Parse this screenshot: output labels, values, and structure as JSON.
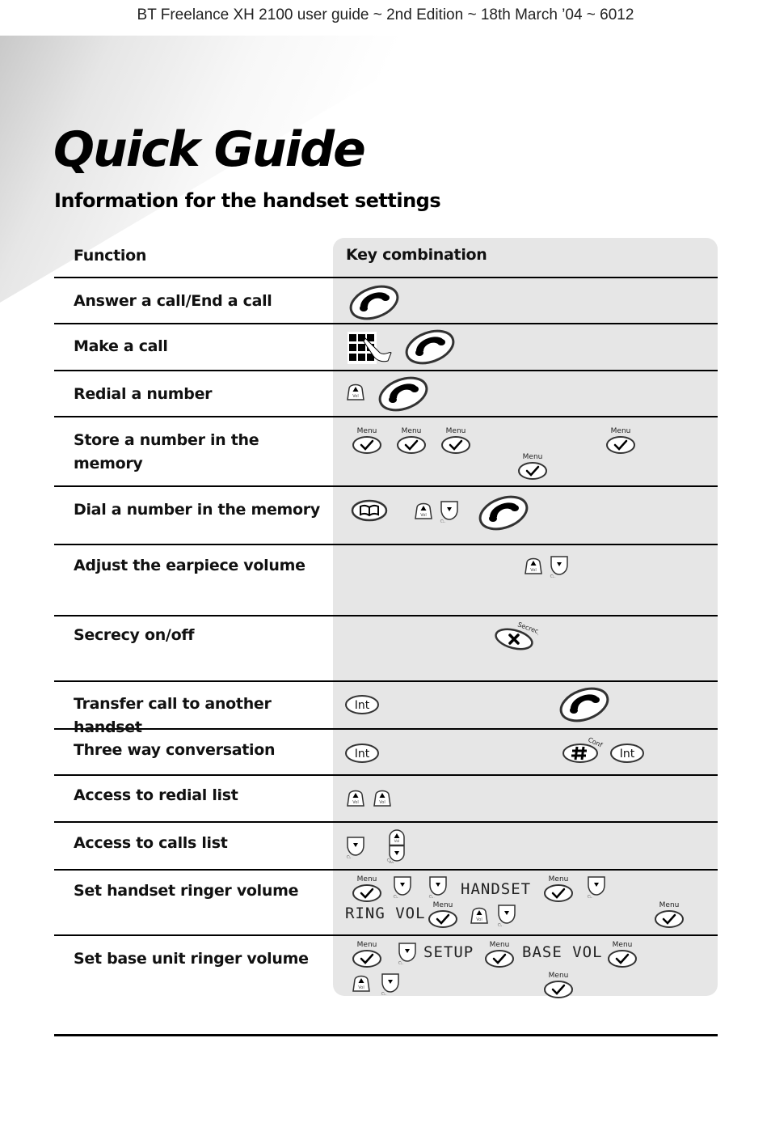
{
  "running_head": "BT Freelance XH 2100 user guide ~ 2nd Edition ~ 18th March ’04 ~ 6012",
  "title": "Quick Guide",
  "subtitle": "Information for the handset settings",
  "table": {
    "headers": {
      "function": "Function",
      "keys": "Key combination"
    },
    "rows": [
      {
        "function": "Answer a call/End a call",
        "keys": [
          "talk-key"
        ]
      },
      {
        "function": "Make a call",
        "keys": [
          "keypad",
          "talk-key"
        ]
      },
      {
        "function": "Redial a number",
        "keys": [
          "vol-up-key",
          "talk-key"
        ]
      },
      {
        "function": "Store a number in the memory",
        "keys": [
          "menu-key",
          "menu-key",
          "menu-key",
          "menu-key",
          "menu-key"
        ]
      },
      {
        "function": "Dial a number in the memory",
        "keys": [
          "phonebook-key",
          "vol-up-key",
          "calls-down-key",
          "talk-key"
        ]
      },
      {
        "function": "Adjust the earpiece volume",
        "keys": [
          "vol-up-key",
          "calls-down-key"
        ]
      },
      {
        "function": "Secrecy on/off",
        "keys": [
          "secrecy-key"
        ]
      },
      {
        "function": "Transfer call to another handset",
        "keys": [
          "int-key",
          "talk-key"
        ]
      },
      {
        "function": "Three way conversation",
        "keys": [
          "int-key",
          "conf-hash-key",
          "int-key"
        ]
      },
      {
        "function": "Access to redial list",
        "keys": [
          "vol-up-key",
          "vol-up-key"
        ]
      },
      {
        "function": "Access to calls list",
        "keys": [
          "calls-down-key",
          "vol-rocker-key"
        ]
      },
      {
        "function": "Set handset ringer volume",
        "keys": [
          "menu-key",
          "calls-down-key",
          "calls-down-key",
          "HANDSET",
          "menu-key",
          "calls-down-key",
          "RING VOL",
          "menu-key",
          "vol-up-key",
          "calls-down-key",
          "menu-key"
        ]
      },
      {
        "function": "Set base unit ringer volume",
        "keys": [
          "menu-key",
          "calls-down-key",
          "SETUP",
          "menu-key",
          "BASE VOL",
          "menu-key",
          "vol-up-key",
          "calls-down-key",
          "menu-key"
        ]
      }
    ]
  },
  "key_labels": {
    "menu": "Menu",
    "vol": "Vol",
    "calls": "Calls",
    "int": "Int",
    "secrecy": "Secrecy",
    "conf": "Conf"
  },
  "lcd": {
    "handset": "HANDSET",
    "ring_vol": "RING VOL",
    "setup": "SETUP",
    "base_vol": "BASE VOL"
  }
}
